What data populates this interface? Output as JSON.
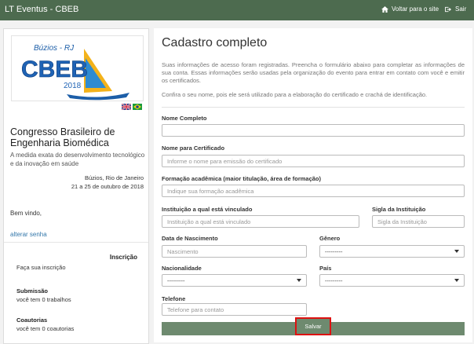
{
  "navbar": {
    "brand": "LT Eventus - CBEB",
    "back_label": "Voltar para o site",
    "exit_label": "Sair"
  },
  "sidebar": {
    "logo": {
      "top": "Búzios - RJ",
      "main": "CBEB",
      "year": "2018"
    },
    "conference_title": "Congresso Brasileiro de Engenharia Biomédica",
    "conference_desc": "A medida exata do desenvolvimento tecnológico e da inovação em saúde",
    "location": "Búzios, Rio de Janeiro",
    "dates": "21 a 25 de outubro de 2018",
    "welcome": "Bem vindo,",
    "change_password": "alterar senha",
    "registration_heading": "Inscrição",
    "registration_item": "Faça sua inscrição",
    "submission_title": "Submissão",
    "submission_text": "você tem 0 trabalhos",
    "coauthor_title": "Coautorias",
    "coauthor_text": "você tem 0 coautorias"
  },
  "main": {
    "title": "Cadastro completo",
    "intro": "Suas informações de acesso foram registradas. Preencha o formulário abaixo para completar as informações de sua conta. Essas informações serão usadas pela organização do evento para entrar em contato com você e emitir os certificados.",
    "confirm_note": "Confira o seu nome, pois ele será utilizado para a elaboração do certificado e crachá de identificação.",
    "fields": {
      "full_name": {
        "label": "Nome Completo",
        "value": ""
      },
      "cert_name": {
        "label": "Nome para Certificado",
        "placeholder": "Informe o nome para emissão do certificado"
      },
      "education": {
        "label": "Formação acadêmica (maior titulação, área de formação)",
        "placeholder": "Indique sua formação acadêmica"
      },
      "institution": {
        "label": "Instituição a qual está vinculado",
        "placeholder": "Instituição a qual está vinculado"
      },
      "institution_acronym": {
        "label": "Sigla da Instituição",
        "placeholder": "Sigla da Instituição"
      },
      "birth_date": {
        "label": "Data de Nascimento",
        "placeholder": "Nascimento"
      },
      "gender": {
        "label": "Gênero",
        "selected": "---------"
      },
      "nationality": {
        "label": "Nacionalidade",
        "selected": "---------"
      },
      "country": {
        "label": "País",
        "selected": "---------"
      },
      "phone": {
        "label": "Telefone",
        "placeholder": "Telefone para contato"
      }
    },
    "save_label": "Salvar"
  }
}
